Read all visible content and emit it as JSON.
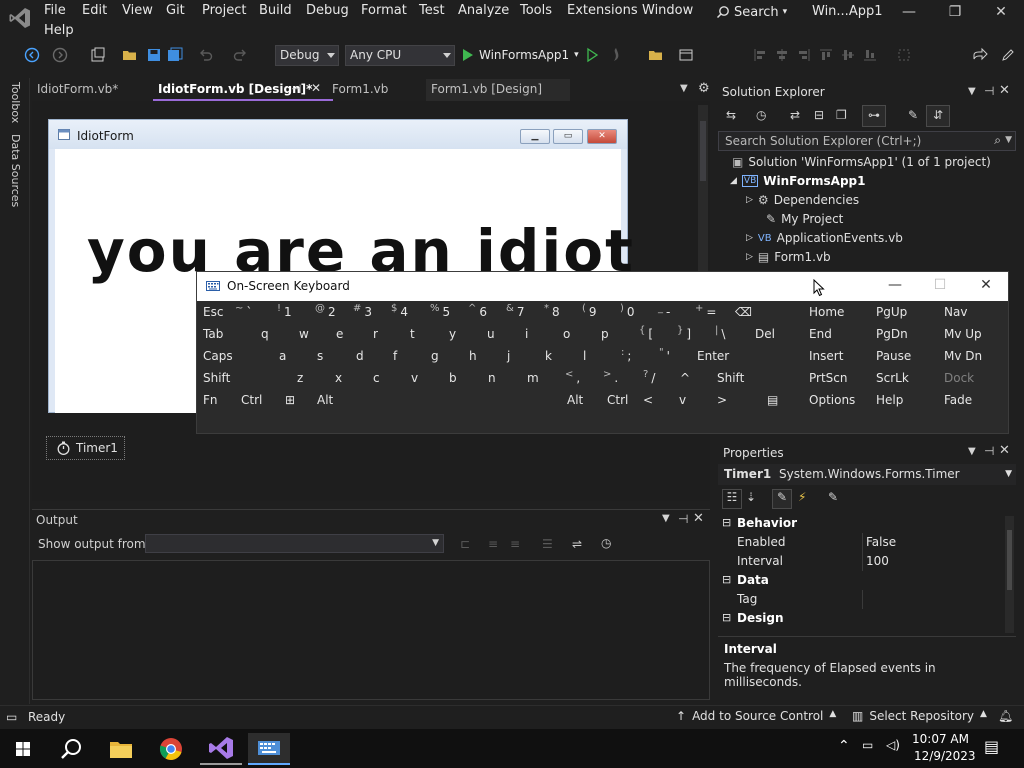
{
  "menu": {
    "row1": [
      "File",
      "Edit",
      "View",
      "Git",
      "Project",
      "Build",
      "Debug",
      "Format",
      "Test",
      "Analyze",
      "Tools",
      "Extensions",
      "Window"
    ],
    "row2": [
      "Help"
    ],
    "search_label": "Search",
    "solution_title": "Win...App1"
  },
  "toolbar": {
    "config": "Debug",
    "platform": "Any CPU",
    "run_label": "WinFormsApp1"
  },
  "left_strip": {
    "toolbox": "Toolbox",
    "data_sources": "Data Sources"
  },
  "doc_tabs": [
    {
      "label": "IdiotForm.vb*"
    },
    {
      "label": "IdiotForm.vb [Design]*"
    },
    {
      "label": "Form1.vb"
    },
    {
      "label": "Form1.vb [Design]"
    }
  ],
  "designer": {
    "form_title": "IdiotForm",
    "form_text": "you are an idiot",
    "component": "Timer1"
  },
  "osk": {
    "title": "On-Screen Keyboard",
    "rows": [
      [
        {
          "k": "Esc"
        },
        {
          "s": "~",
          "k": "`"
        },
        {
          "s": "!",
          "k": "1"
        },
        {
          "s": "@",
          "k": "2"
        },
        {
          "s": "#",
          "k": "3"
        },
        {
          "s": "$",
          "k": "4"
        },
        {
          "s": "%",
          "k": "5"
        },
        {
          "s": "^",
          "k": "6"
        },
        {
          "s": "&",
          "k": "7"
        },
        {
          "s": "*",
          "k": "8"
        },
        {
          "s": "(",
          "k": "9"
        },
        {
          "s": ")",
          "k": "0"
        },
        {
          "s": "_",
          "k": "-"
        },
        {
          "s": "+",
          "k": "="
        },
        {
          "k": "⌫"
        }
      ],
      [
        {
          "k": "Tab"
        },
        {
          "k": "q"
        },
        {
          "k": "w"
        },
        {
          "k": "e"
        },
        {
          "k": "r"
        },
        {
          "k": "t"
        },
        {
          "k": "y"
        },
        {
          "k": "u"
        },
        {
          "k": "i"
        },
        {
          "k": "o"
        },
        {
          "k": "p"
        },
        {
          "s": "{",
          "k": "["
        },
        {
          "s": "}",
          "k": "]"
        },
        {
          "s": "|",
          "k": "\\"
        },
        {
          "k": "Del"
        }
      ],
      [
        {
          "k": "Caps"
        },
        {
          "k": "a"
        },
        {
          "k": "s"
        },
        {
          "k": "d"
        },
        {
          "k": "f"
        },
        {
          "k": "g"
        },
        {
          "k": "h"
        },
        {
          "k": "j"
        },
        {
          "k": "k"
        },
        {
          "k": "l"
        },
        {
          "s": ":",
          "k": ";"
        },
        {
          "s": "\"",
          "k": "'"
        },
        {
          "k": "Enter"
        }
      ],
      [
        {
          "k": "Shift"
        },
        {
          "k": "z"
        },
        {
          "k": "x"
        },
        {
          "k": "c"
        },
        {
          "k": "v"
        },
        {
          "k": "b"
        },
        {
          "k": "n"
        },
        {
          "k": "m"
        },
        {
          "s": "<",
          "k": ","
        },
        {
          "s": ">",
          "k": "."
        },
        {
          "s": "?",
          "k": "/"
        },
        {
          "k": "^"
        },
        {
          "k": "Shift"
        }
      ],
      [
        {
          "k": "Fn"
        },
        {
          "k": "Ctrl"
        },
        {
          "k": "⊞"
        },
        {
          "k": "Alt"
        },
        {
          "k": "Alt"
        },
        {
          "k": "Ctrl"
        },
        {
          "k": "<"
        },
        {
          "k": "v"
        },
        {
          "k": ">"
        },
        {
          "k": "▤"
        }
      ]
    ],
    "nav": [
      [
        "Home",
        "PgUp",
        "Nav"
      ],
      [
        "End",
        "PgDn",
        "Mv Up"
      ],
      [
        "Insert",
        "Pause",
        "Mv Dn"
      ],
      [
        "PrtScn",
        "ScrLk",
        "Dock"
      ],
      [
        "Options",
        "Help",
        "Fade"
      ]
    ]
  },
  "output": {
    "title": "Output",
    "show_from": "Show output from:",
    "show_from_value": ""
  },
  "solution_explorer": {
    "title": "Solution Explorer",
    "search_placeholder": "Search Solution Explorer (Ctrl+;)",
    "tree": [
      {
        "label": "Solution 'WinFormsApp1' (1 of 1 project)"
      },
      {
        "label": "WinFormsApp1"
      },
      {
        "label": "Dependencies"
      },
      {
        "label": "My Project"
      },
      {
        "label": "ApplicationEvents.vb"
      },
      {
        "label": "Form1.vb"
      }
    ]
  },
  "properties": {
    "title": "Properties",
    "object_name": "Timer1",
    "object_type": "System.Windows.Forms.Timer",
    "rows": [
      {
        "type": "cat",
        "name": "Behavior"
      },
      {
        "type": "prop",
        "name": "Enabled",
        "value": "False"
      },
      {
        "type": "prop",
        "name": "Interval",
        "value": "100"
      },
      {
        "type": "cat",
        "name": "Data"
      },
      {
        "type": "prop",
        "name": "Tag",
        "value": ""
      },
      {
        "type": "cat",
        "name": "Design"
      }
    ],
    "desc_title": "Interval",
    "desc_text": "The frequency of Elapsed events in milliseconds."
  },
  "status": {
    "ready": "Ready",
    "source_control": "Add to Source Control",
    "repository": "Select Repository"
  },
  "taskbar": {
    "time": "10:07 AM",
    "date": "12/9/2023"
  },
  "colors": {
    "accent": "#9a6bd8",
    "run_green": "#3fb950",
    "background": "#1f1f1f"
  }
}
